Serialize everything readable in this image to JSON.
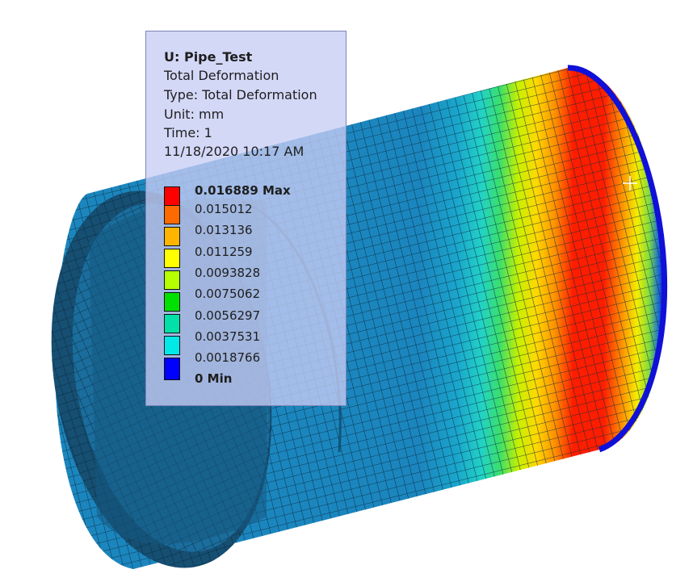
{
  "legend": {
    "title": "U: Pipe_Test",
    "result": "Total Deformation",
    "type": "Type: Total Deformation",
    "unit": "Unit: mm",
    "time": "Time: 1",
    "datetime": "11/18/2020 10:17 AM",
    "scale": [
      {
        "label": "0.016889 Max",
        "color": "#ff0000",
        "bold": true
      },
      {
        "label": "0.015012",
        "color": "#ff6a00"
      },
      {
        "label": "0.013136",
        "color": "#ffb400"
      },
      {
        "label": "0.011259",
        "color": "#ffff00"
      },
      {
        "label": "0.0093828",
        "color": "#b4ff00"
      },
      {
        "label": "0.0075062",
        "color": "#00e000"
      },
      {
        "label": "0.0056297",
        "color": "#00e0a8"
      },
      {
        "label": "0.0037531",
        "color": "#00e8e8"
      },
      {
        "label": "0.0018766",
        "color": "#00a8ff"
      },
      {
        "label": "0 Min",
        "color": "#0000ff",
        "bold": true
      }
    ]
  },
  "model": {
    "name": "pipe",
    "base_color": "#1a7fb4",
    "edge_color": "#0a2a40"
  }
}
